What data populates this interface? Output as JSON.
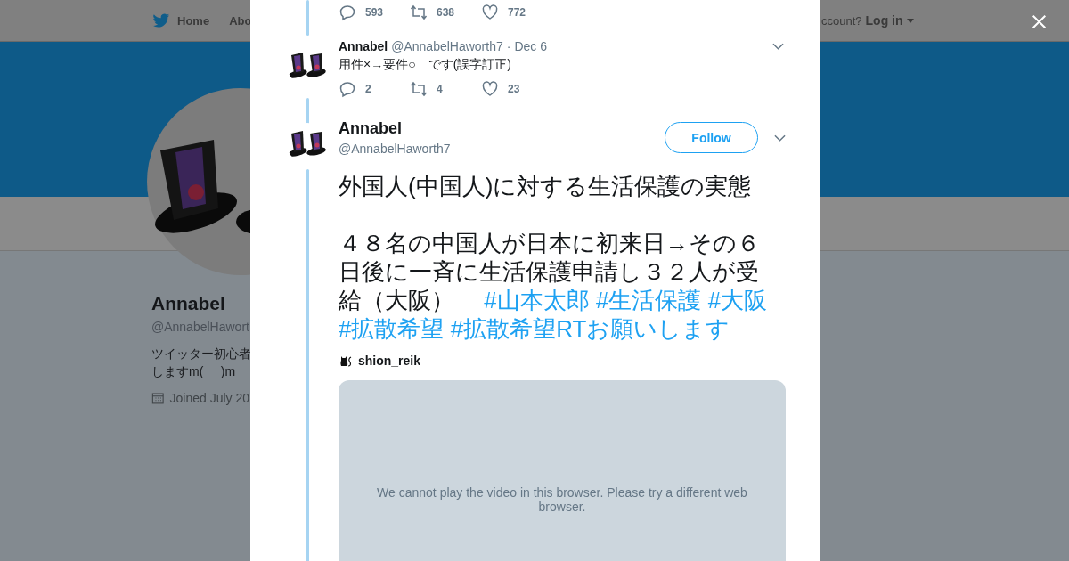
{
  "nav": {
    "items": [
      {
        "label": "Home",
        "kind": "home"
      },
      {
        "label": "Abo",
        "kind": "plain"
      }
    ],
    "login_prompt": "ccount?",
    "login": "Log in"
  },
  "profile": {
    "name": "Annabel",
    "handle": "@AnnabelHawort",
    "bio": [
      "ツイッター初心者",
      "しますm(_ _)m"
    ],
    "joined": "Joined July 20"
  },
  "previous_actions": {
    "reply": "593",
    "retweet": "638",
    "like": "772"
  },
  "reply_tweet": {
    "name": "Annabel",
    "handle": "@AnnabelHaworth7",
    "dot": "·",
    "date": "Dec 6",
    "text": "用件×→要件○　です(誤字訂正)",
    "actions": {
      "reply": "2",
      "retweet": "4",
      "like": "23"
    }
  },
  "main_tweet": {
    "name": "Annabel",
    "handle": "@AnnabelHaworth7",
    "follow": "Follow",
    "paragraphs": [
      [
        {
          "kind": "text",
          "text": "外国人(中国人)に対する生活保護の実態"
        }
      ],
      [
        {
          "kind": "text",
          "text": "４８名の中国人が日本に初来日→その６日後に一斉に生活保護申請し３２人が受給（大阪）　"
        },
        {
          "kind": "hashtag",
          "text": "#山本太郎"
        },
        {
          "kind": "hashtag",
          "text": "#生活保護"
        },
        {
          "kind": "hashtag",
          "text": "#大阪"
        },
        {
          "kind": "hashtag",
          "text": "#拡散希望"
        },
        {
          "kind": "hashtag",
          "text": "#拡散希望RTお願いします"
        }
      ]
    ],
    "source": "shion_reik",
    "video": {
      "message": "We cannot play the video in this browser. Please try a different web browser."
    }
  }
}
